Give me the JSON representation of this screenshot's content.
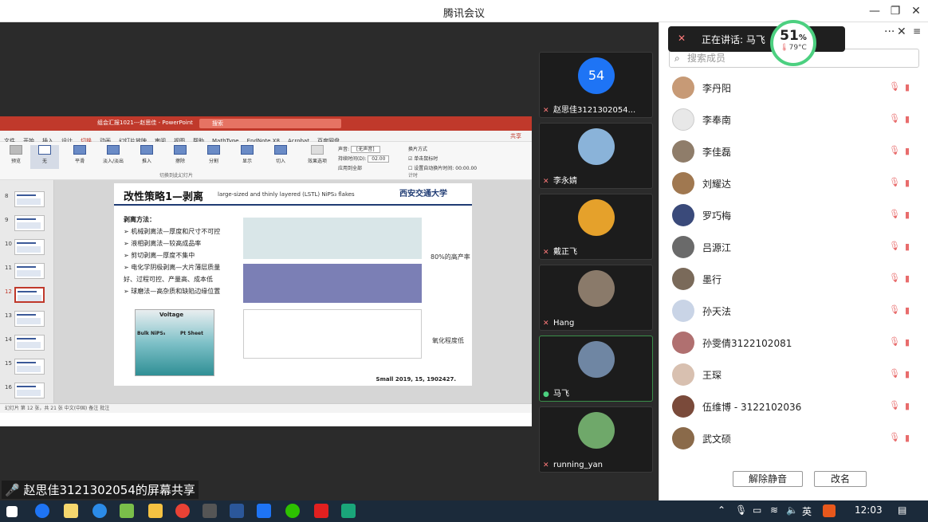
{
  "window": {
    "title": "腾讯会议"
  },
  "share": {
    "label": "赵思佳3121302054的屏幕共享"
  },
  "ppt": {
    "file_title": "组会汇报1021---赵思佳 - PowerPoint",
    "search_placeholder": "搜索",
    "tabs": [
      "文件",
      "开始",
      "插入",
      "设计",
      "切换",
      "动画",
      "幻灯片放映",
      "审阅",
      "视图",
      "帮助",
      "MathType",
      "EndNote X8",
      "Acrobat",
      "百度网盘"
    ],
    "active_tab": "切换",
    "share_label": "共享",
    "ribbon": {
      "preview": "预览",
      "effects": [
        "无",
        "平滑",
        "淡入/淡出",
        "推入",
        "擦除",
        "分割",
        "显示",
        "切入",
        "效果选项"
      ],
      "group_label": "切换到此幻灯片",
      "timing": {
        "sound": "声音:",
        "sound_value": "[无声音]",
        "duration": "持续时间(D):",
        "duration_value": "02.00",
        "apply_all": "应用到全部",
        "switch_mode": "换片方式",
        "on_click": "单击鼠标时",
        "auto_after": "设置自动换片时间:",
        "auto_value": "00:00.00",
        "timing_label": "计时"
      }
    },
    "thumbs": [
      "8",
      "9",
      "10",
      "11",
      "12",
      "13",
      "14",
      "15",
      "16"
    ],
    "selected_thumb": "12",
    "slide": {
      "title": "改性策略1—剥离",
      "subtitle": "large-sized and thinly layered (LSTL) NiPS₃ flakes",
      "logo": "西安交通大学",
      "method_head": "剥离方法：",
      "methods": [
        "➢ 机械剥离法—厚度和尺寸不可控",
        "➢ 液相剥离法—较高成品率",
        "➢ 剪切剥离—厚度不集中",
        "➢ 电化学阴极剥离—大片薄层质量",
        "   好、过程可控、产量高、成本低",
        "➢ 球磨法—高杂质和缺陷边缘位置"
      ],
      "note_yield": "80%的高产率",
      "note_ox": "氧化程度低",
      "voltage": "Voltage",
      "bulk": "Bulk NiPS₃",
      "pt": "Pt Sheet",
      "ref": "Small 2019, 15, 1902427."
    },
    "status": "幻灯片 第 12 张，共 21 张    中文(中国)    备注  批注"
  },
  "tiles": [
    {
      "name": "赵思佳3121302054...",
      "avatar_text": "54",
      "color": "#1e74f5"
    },
    {
      "name": "李永婧",
      "color": "#8ab3d9"
    },
    {
      "name": "戴正飞",
      "color": "#e5a12b"
    },
    {
      "name": "Hang",
      "color": "#8a7a6a"
    },
    {
      "name": "马飞",
      "color": "#6f86a3"
    },
    {
      "name": "running_yan",
      "color": "#6fa86a"
    }
  ],
  "panel": {
    "speaking": "正在讲话: 马飞",
    "gauge_value": "51",
    "gauge_unit": "%",
    "gauge_temp": "79°C",
    "search_placeholder": "搜索成员",
    "members": [
      {
        "name": "李丹阳",
        "color": "#c79a76"
      },
      {
        "name": "李奉南",
        "color": "#e8e8e8"
      },
      {
        "name": "李佳磊",
        "color": "#8f7d6a"
      },
      {
        "name": "刘耀达",
        "color": "#a07850"
      },
      {
        "name": "罗巧梅",
        "color": "#3a4a7a"
      },
      {
        "name": "吕源江",
        "color": "#6a6a6a"
      },
      {
        "name": "墨行",
        "color": "#7a6a5a"
      },
      {
        "name": "孙天法",
        "color": "#c9d4e6"
      },
      {
        "name": "孙雯倩3122102081",
        "color": "#b07070"
      },
      {
        "name": "王琛",
        "color": "#d8c0b0"
      },
      {
        "name": "伍维博 - 3122102036",
        "color": "#7a4a3a"
      },
      {
        "name": "武文硕",
        "color": "#8a6a4a"
      }
    ],
    "unmute_all": "解除静音",
    "rename": "改名"
  },
  "taskbar": {
    "ime": "英",
    "time": "12:03"
  }
}
